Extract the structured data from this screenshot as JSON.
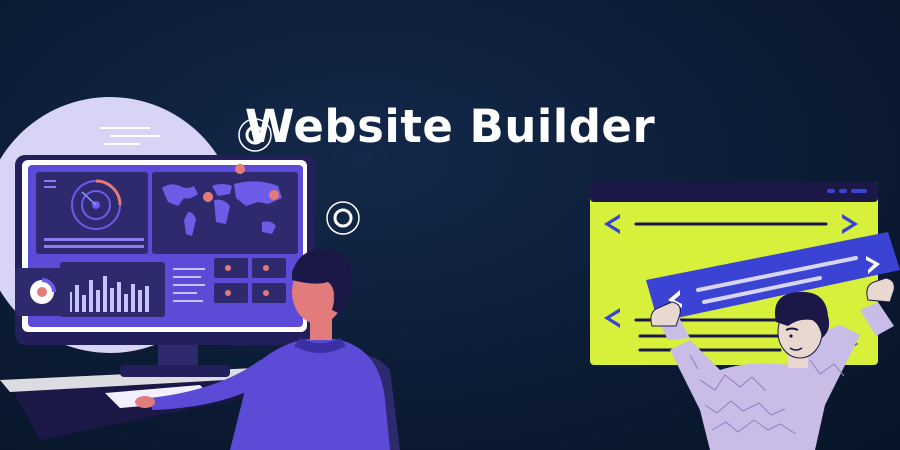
{
  "title": "Website Builder",
  "colors": {
    "background": "#0c1c35",
    "monitor_frame": "#2e2a6e",
    "screen_purple": "#5b4bd6",
    "accent_pink": "#e27c7c",
    "lime_panel": "#d6f03c",
    "arrow_blue": "#3b43d4",
    "lavender": "#d8d4f5"
  },
  "illustrations": {
    "left": "person-at-monitor-dashboard-icon",
    "right": "person-holding-code-window-icon"
  }
}
